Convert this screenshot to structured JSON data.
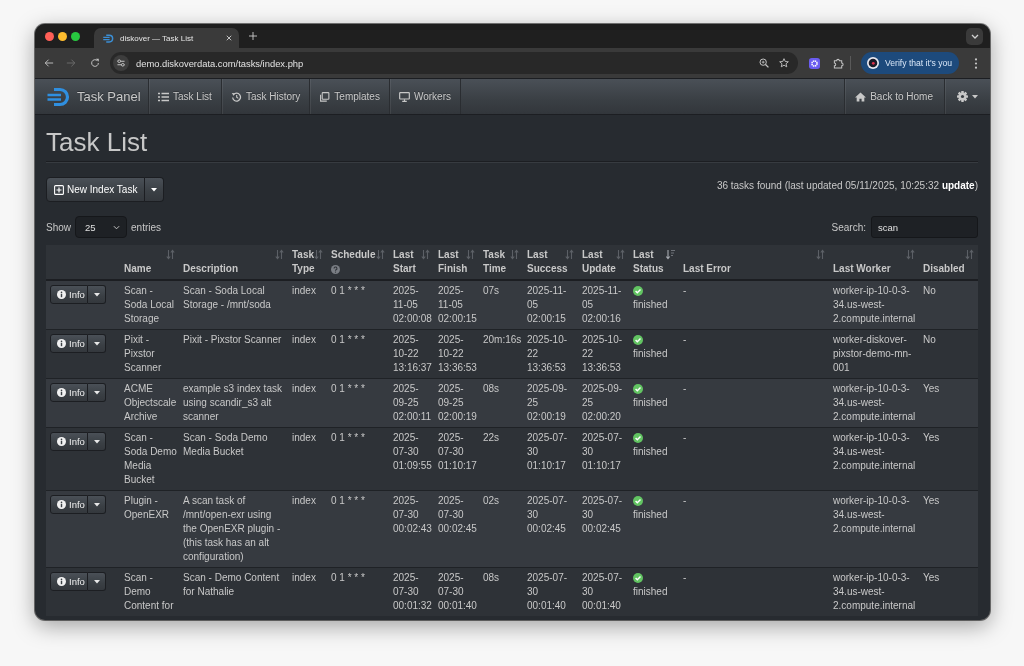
{
  "browser": {
    "tab_title": "diskover — Task List",
    "url": "demo.diskoverdata.com/tasks/index.php",
    "profile_button": "Verify that it's you"
  },
  "navbar": {
    "brand": "Task Panel",
    "items": [
      "Task List",
      "Task History",
      "Templates",
      "Workers"
    ],
    "home_link": "Back to Home"
  },
  "page": {
    "title": "Task List",
    "new_button": "New Index Task",
    "summary": {
      "text": "36 tasks found (last updated 05/11/2025, 10:25:32",
      "link": "update",
      "closing": ")"
    },
    "length": {
      "label": "Show",
      "value": "25",
      "suffix": "entries"
    },
    "search": {
      "label": "Search:",
      "value": "scan"
    }
  },
  "table": {
    "columns": [
      {
        "label": "Name",
        "sorted": false,
        "help": false
      },
      {
        "label": "Description",
        "sorted": false,
        "help": false
      },
      {
        "label": "Task Type",
        "sorted": false,
        "help": false
      },
      {
        "label": "Schedule",
        "sorted": false,
        "help": true
      },
      {
        "label": "Last Start",
        "sorted": false,
        "help": false
      },
      {
        "label": "Last Finish",
        "sorted": false,
        "help": false
      },
      {
        "label": "Task Time",
        "sorted": false,
        "help": false
      },
      {
        "label": "Last Success",
        "sorted": false,
        "help": false
      },
      {
        "label": "Last Update",
        "sorted": false,
        "help": false
      },
      {
        "label": "Last Status",
        "sorted": true,
        "help": false
      },
      {
        "label": "Last Error",
        "sorted": false,
        "help": false
      },
      {
        "label": "Last Worker",
        "sorted": false,
        "help": false
      },
      {
        "label": "Disabled",
        "sorted": false,
        "help": false
      }
    ],
    "rows": [
      {
        "button": "Info",
        "name": "Scan - Soda Local Storage",
        "description": "Scan - Soda Local Storage - /mnt/soda",
        "type": "index",
        "schedule": "0 1 * * *",
        "last_start": "2025-11-05 02:00:08",
        "last_finish": "2025-11-05 02:00:15",
        "task_time": "07s",
        "last_success": "2025-11-05 02:00:15",
        "last_update": "2025-11-05 02:00:16",
        "last_status": "finished",
        "last_error": "-",
        "last_worker": "worker-ip-10-0-3-34.us-west-2.compute.internal",
        "disabled": "No"
      },
      {
        "button": "Info",
        "name": "Pixit - Pixstor Scanner",
        "description": "Pixit - Pixstor Scanner",
        "type": "index",
        "schedule": "0 1 * * *",
        "last_start": "2025-10-22 13:16:37",
        "last_finish": "2025-10-22 13:36:53",
        "task_time": "20m:16s",
        "last_success": "2025-10-22 13:36:53",
        "last_update": "2025-10-22 13:36:53",
        "last_status": "finished",
        "last_error": "-",
        "last_worker": "worker-diskover-pixstor-demo-mn-001",
        "disabled": "No"
      },
      {
        "button": "Info",
        "name": "ACME Objectscale Archive",
        "description": "example s3 index task using scandir_s3 alt scanner",
        "type": "index",
        "schedule": "0 1 * * *",
        "last_start": "2025-09-25 02:00:11",
        "last_finish": "2025-09-25 02:00:19",
        "task_time": "08s",
        "last_success": "2025-09-25 02:00:19",
        "last_update": "2025-09-25 02:00:20",
        "last_status": "finished",
        "last_error": "-",
        "last_worker": "worker-ip-10-0-3-34.us-west-2.compute.internal",
        "disabled": "Yes"
      },
      {
        "button": "Info",
        "name": "Scan - Soda Demo Media Bucket",
        "description": "Scan - Soda Demo Media Bucket",
        "type": "index",
        "schedule": "0 1 * * *",
        "last_start": "2025-07-30 01:09:55",
        "last_finish": "2025-07-30 01:10:17",
        "task_time": "22s",
        "last_success": "2025-07-30 01:10:17",
        "last_update": "2025-07-30 01:10:17",
        "last_status": "finished",
        "last_error": "-",
        "last_worker": "worker-ip-10-0-3-34.us-west-2.compute.internal",
        "disabled": "Yes"
      },
      {
        "button": "Info",
        "name": "Plugin - OpenEXR",
        "description": "A scan task of /mnt/open-exr using the OpenEXR plugin - (this task has an alt configuration)",
        "type": "index",
        "schedule": "0 1 * * *",
        "last_start": "2025-07-30 00:02:43",
        "last_finish": "2025-07-30 00:02:45",
        "task_time": "02s",
        "last_success": "2025-07-30 00:02:45",
        "last_update": "2025-07-30 00:02:45",
        "last_status": "finished",
        "last_error": "-",
        "last_worker": "worker-ip-10-0-3-34.us-west-2.compute.internal",
        "disabled": "Yes"
      },
      {
        "button": "Info",
        "name": "Scan - Demo Content for",
        "description": "Scan - Demo Content for Nathalie",
        "type": "index",
        "schedule": "0 1 * * *",
        "last_start": "2025-07-30 00:01:32",
        "last_finish": "2025-07-30 00:01:40",
        "task_time": "08s",
        "last_success": "2025-07-30 00:01:40",
        "last_update": "2025-07-30 00:01:40",
        "last_status": "finished",
        "last_error": "-",
        "last_worker": "worker-ip-10-0-3-34.us-west-2.compute.internal",
        "disabled": "Yes"
      }
    ]
  }
}
